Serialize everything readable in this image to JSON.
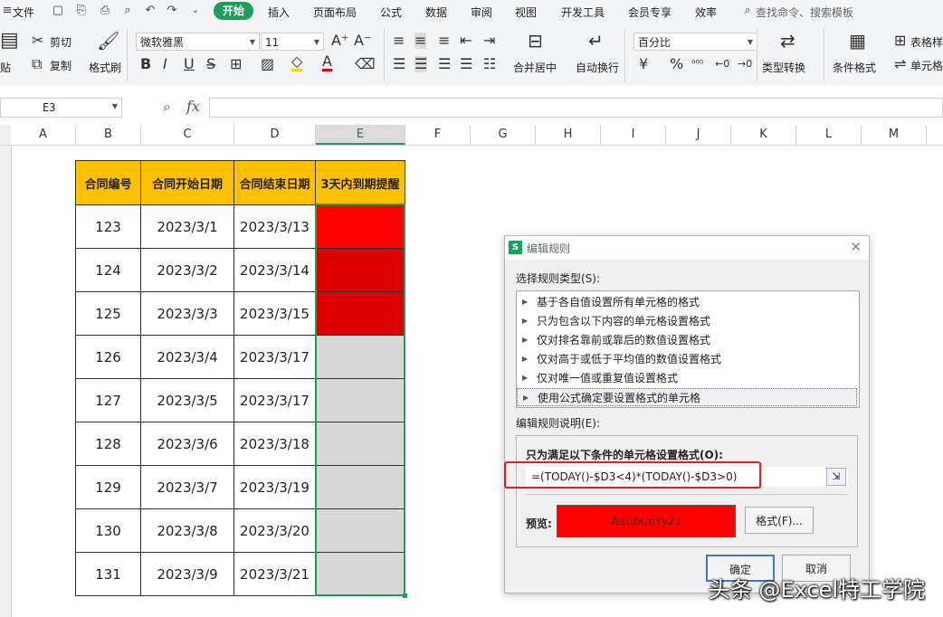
{
  "menu": {
    "file": "文件",
    "tabs": [
      "开始",
      "插入",
      "页面布局",
      "公式",
      "数据",
      "审阅",
      "视图",
      "开发工具",
      "会员专享",
      "效率"
    ],
    "search": "查找命令、搜索模板"
  },
  "ribbon": {
    "paste": "贴",
    "cut": "剪切",
    "copy": "复制",
    "format_painter": "格式刷",
    "font_name": "微软雅黑",
    "font_size": "11",
    "merge_center": "合并居中",
    "wrap_text": "自动换行",
    "number_format": "百分比",
    "type_convert": "类型转换",
    "cond_format": "条件格式",
    "table_style": "表格样",
    "cell_style": "单元格"
  },
  "formula_bar": {
    "name_box": "E3",
    "fx": "fx",
    "formula": ""
  },
  "columns": [
    "A",
    "B",
    "C",
    "D",
    "E",
    "F",
    "G",
    "H",
    "I",
    "J",
    "K",
    "L",
    "M"
  ],
  "table": {
    "headers": [
      "合同编号",
      "合同开始日期",
      "合同结束日期",
      "3天内到期提醒"
    ],
    "rows": [
      {
        "id": "123",
        "start": "2023/3/1",
        "end": "2023/3/13",
        "fill": "#ff0000"
      },
      {
        "id": "124",
        "start": "2023/3/2",
        "end": "2023/3/14",
        "fill": "#dc0000"
      },
      {
        "id": "125",
        "start": "2023/3/3",
        "end": "2023/3/15",
        "fill": "#dc0000"
      },
      {
        "id": "126",
        "start": "2023/3/4",
        "end": "2023/3/17",
        "fill": "#d8d8d8"
      },
      {
        "id": "127",
        "start": "2023/3/5",
        "end": "2023/3/17",
        "fill": "#d8d8d8"
      },
      {
        "id": "128",
        "start": "2023/3/6",
        "end": "2023/3/18",
        "fill": "#d8d8d8"
      },
      {
        "id": "129",
        "start": "2023/3/7",
        "end": "2023/3/19",
        "fill": "#d8d8d8"
      },
      {
        "id": "130",
        "start": "2023/3/8",
        "end": "2023/3/20",
        "fill": "#d8d8d8"
      },
      {
        "id": "131",
        "start": "2023/3/9",
        "end": "2023/3/21",
        "fill": "#d8d8d8"
      }
    ]
  },
  "dialog": {
    "title": "编辑规则",
    "select_type_label": "选择规则类型(S):",
    "rule_types": [
      "基于各自值设置所有单元格的格式",
      "只为包含以下内容的单元格设置格式",
      "仅对排名靠前或靠后的数值设置格式",
      "仅对高于或低于平均值的数值设置格式",
      "仅对唯一值或重复值设置格式",
      "使用公式确定要设置格式的单元格"
    ],
    "edit_desc_label": "编辑规则说明(E):",
    "condition_label": "只为满足以下条件的单元格设置格式(O):",
    "formula": "=(TODAY()-$D3<4)*(TODAY()-$D3>0)",
    "preview_label": "预览:",
    "preview_text": "AaBbCcYyZz",
    "preview_fill": "#ff0000",
    "format_button": "格式(F)...",
    "ok": "确定",
    "cancel": "取消"
  },
  "watermark": "头条 @Excel特工学院",
  "colors": {
    "accent": "#1f9e5a",
    "header_fill": "#ffc000",
    "highlight_box": "#e02020"
  }
}
